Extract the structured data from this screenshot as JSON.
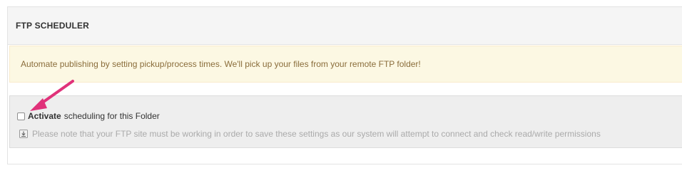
{
  "panel": {
    "title": "FTP SCHEDULER"
  },
  "alert": {
    "message": "Automate publishing by setting pickup/process times. We'll pick up your files from your remote FTP folder!"
  },
  "settings": {
    "activate_strong": "Activate",
    "activate_rest": "scheduling for this Folder",
    "activate_checked": false,
    "note": "Please note that your FTP site must be working in order to save these settings as our system will attempt to connect and check read/write permissions"
  },
  "annotation": {
    "arrow_color": "#e0327a"
  },
  "icons": {
    "note_icon": "download-icon"
  }
}
